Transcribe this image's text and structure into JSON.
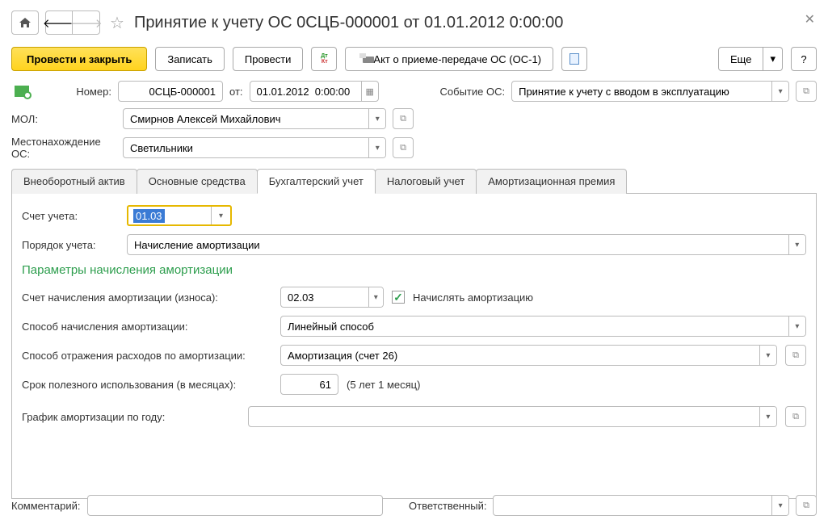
{
  "title": "Принятие к учету ОС 0СЦБ-000001 от 01.01.2012 0:00:00",
  "toolbar": {
    "post_close": "Провести и закрыть",
    "write": "Записать",
    "post": "Провести",
    "act": "Акт о приеме-передаче ОС (ОС-1)",
    "more": "Еще",
    "help": "?"
  },
  "header": {
    "number_label": "Номер:",
    "number": "0СЦБ-000001",
    "from_label": "от:",
    "date": "01.01.2012  0:00:00",
    "event_label": "Событие ОС:",
    "event_value": "Принятие к учету с вводом в эксплуатацию",
    "mol_label": "МОЛ:",
    "mol_value": "Смирнов Алексей Михайлович",
    "location_label": "Местонахождение ОС:",
    "location_value": "Светильники"
  },
  "tabs": {
    "t1": "Внеоборотный актив",
    "t2": "Основные средства",
    "t3": "Бухгалтерский учет",
    "t4": "Налоговый учет",
    "t5": "Амортизационная премия"
  },
  "acc": {
    "account_label": "Счет учета:",
    "account_value": "01.03",
    "order_label": "Порядок учета:",
    "order_value": "Начисление амортизации",
    "section": "Параметры начисления амортизации",
    "depr_acc_label": "Счет начисления амортизации (износа):",
    "depr_acc_value": "02.03",
    "calc_depr": "Начислять амортизацию",
    "method_label": "Способ начисления амортизации:",
    "method_value": "Линейный способ",
    "expense_label": "Способ отражения расходов по амортизации:",
    "expense_value": "Амортизация (счет 26)",
    "life_label": "Срок полезного использования (в месяцах):",
    "life_value": "61",
    "life_hint": "(5 лет 1 месяц)",
    "schedule_label": "График амортизации по году:",
    "schedule_value": ""
  },
  "footer": {
    "comment_label": "Комментарий:",
    "comment_value": "",
    "responsible_label": "Ответственный:",
    "responsible_value": ""
  }
}
